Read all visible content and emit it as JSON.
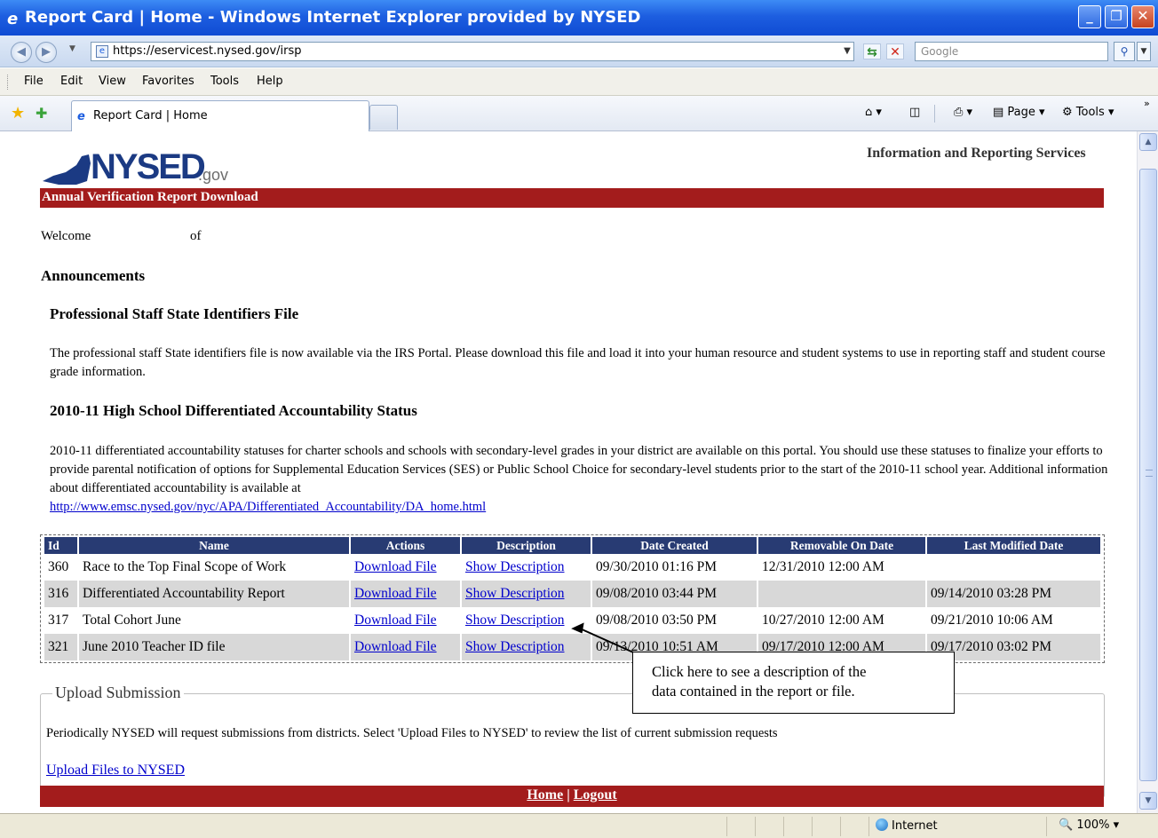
{
  "window": {
    "title": "Report Card | Home - Windows Internet Explorer provided by NYSED"
  },
  "browser": {
    "url": "https://eservicest.nysed.gov/irsp",
    "search_placeholder": "Google",
    "menu": [
      "File",
      "Edit",
      "View",
      "Favorites",
      "Tools",
      "Help"
    ],
    "tab_title": "Report Card | Home",
    "commands": {
      "page": "Page",
      "tools": "Tools"
    },
    "status_zone": "Internet",
    "zoom": "100%"
  },
  "site": {
    "logo_text": "NYSED",
    "logo_domain": ".gov",
    "tagline": "Information and Reporting Services",
    "section_title": "Annual Verification Report Download",
    "welcome": "Welcome",
    "welcome_of": "of",
    "announcements_heading": "Announcements"
  },
  "announcements": [
    {
      "title": "Professional Staff State Identifiers File",
      "body": "The professional staff State identifiers file is now available via the IRS Portal. Please download this file and load it into your human resource and student systems to use in reporting staff and student course grade information."
    },
    {
      "title": "2010-11 High School Differentiated Accountability Status",
      "body": "2010-11 differentiated accountability statuses for charter schools and schools with secondary-level grades in your district are available on this portal. You should use these statuses to finalize your efforts to provide parental notification of options for Supplemental Education Services (SES) or Public School Choice for secondary-level students prior to the start of the 2010-11 school year. Additional information about differentiated accountability is available at",
      "link": "http://www.emsc.nysed.gov/nyc/APA/Differentiated_Accountability/DA_home.html"
    }
  ],
  "table": {
    "headers": [
      "Id",
      "Name",
      "Actions",
      "Description",
      "Date Created",
      "Removable On Date",
      "Last Modified Date"
    ],
    "rows": [
      {
        "id": "360",
        "name": "Race to the Top Final Scope of Work",
        "action": "Download File",
        "description": "Show Description",
        "created": "09/30/2010 01:16 PM",
        "removable": "12/31/2010 12:00 AM",
        "modified": ""
      },
      {
        "id": "316",
        "name": "Differentiated Accountability Report",
        "action": "Download File",
        "description": "Show Description",
        "created": "09/08/2010 03:44 PM",
        "removable": "",
        "modified": "09/14/2010 03:28 PM"
      },
      {
        "id": "317",
        "name": "Total Cohort June",
        "action": "Download File",
        "description": "Show Description",
        "created": "09/08/2010 03:50 PM",
        "removable": "10/27/2010 12:00 AM",
        "modified": "09/21/2010 10:06 AM"
      },
      {
        "id": "321",
        "name": "June 2010 Teacher ID file",
        "action": "Download File",
        "description": "Show Description",
        "created": "09/13/2010 10:51 AM",
        "removable": "09/17/2010 12:00 AM",
        "modified": "09/17/2010 03:02 PM"
      }
    ]
  },
  "callout": {
    "line1": "Click here to see a description of the",
    "line2": "data contained in the report or file."
  },
  "upload": {
    "legend": "Upload Submission",
    "text": "Periodically NYSED will request submissions from districts. Select 'Upload Files to NYSED' to review the list of current submission requests",
    "link": "Upload Files to NYSED"
  },
  "footer": {
    "home": "Home",
    "separator": "|",
    "logout": "Logout"
  }
}
